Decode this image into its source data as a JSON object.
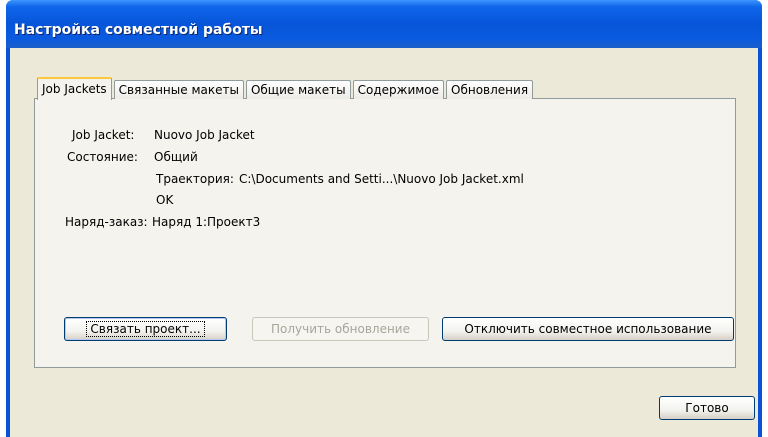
{
  "window": {
    "title": "Настройка совместной работы"
  },
  "tabs": [
    {
      "label": "Job Jackets",
      "active": true
    },
    {
      "label": "Связанные макеты",
      "active": false
    },
    {
      "label": "Общие макеты",
      "active": false
    },
    {
      "label": "Содержимое",
      "active": false
    },
    {
      "label": "Обновления",
      "active": false
    }
  ],
  "info": {
    "job_jacket_label": "Job Jacket:",
    "job_jacket_value": "Nuovo Job Jacket",
    "state_label": "Состояние:",
    "state_value": "Общий",
    "path_label": "Траектория:",
    "path_value": "C:\\Documents and Setti...\\Nuovo Job Jacket.xml",
    "status": "OK",
    "ticket_label": "Наряд-заказ:",
    "ticket_value": "Наряд 1:Проект3"
  },
  "buttons": {
    "link_project": "Связать проект...",
    "get_update": "Получить обновление",
    "disable_sharing": "Отключить совместное использование",
    "done": "Готово"
  }
}
